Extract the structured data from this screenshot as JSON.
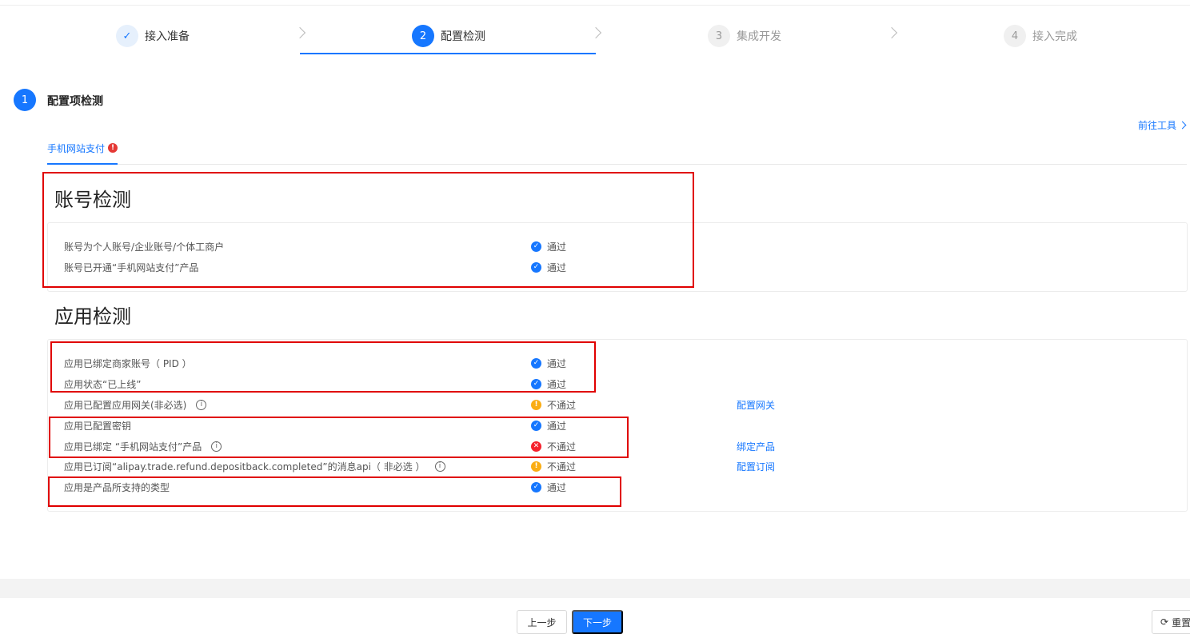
{
  "steps": [
    {
      "num": "✓",
      "label": "接入准备",
      "state": "done"
    },
    {
      "num": "2",
      "label": "配置检测",
      "state": "active"
    },
    {
      "num": "3",
      "label": "集成开发",
      "state": "todo"
    },
    {
      "num": "4",
      "label": "接入完成",
      "state": "todo"
    }
  ],
  "section": {
    "num": "1",
    "title": "配置项检测",
    "goto_tools": "前往工具"
  },
  "tab": {
    "label": "手机网站支付",
    "warn": "!"
  },
  "account": {
    "title": "账号检测",
    "rows": [
      {
        "label": "账号为个人账号/企业账号/个体工商户",
        "status": "通过"
      },
      {
        "label": "账号已开通“手机网站支付”产品",
        "status": "通过"
      }
    ]
  },
  "app": {
    "title": "应用检测",
    "rows": [
      {
        "label": "应用已绑定商家账号（ PID ）",
        "status": "通过",
        "action": ""
      },
      {
        "label": "应用状态“已上线”",
        "status": "通过",
        "action": ""
      },
      {
        "label": "应用已配置应用网关(非必选)",
        "status": "不通过",
        "action": "配置网关"
      },
      {
        "label": "应用已配置密钥",
        "status": "通过",
        "action": ""
      },
      {
        "label": "应用已绑定 “手机网站支付”产品",
        "status": "不通过",
        "action": "绑定产品"
      },
      {
        "label": "应用已订阅“alipay.trade.refund.depositback.completed”的消息api（ 非必选 ）",
        "status": "不通过",
        "action": "配置订阅"
      },
      {
        "label": "应用是产品所支持的类型",
        "status": "通过",
        "action": ""
      }
    ]
  },
  "footer": {
    "prev": "上一步",
    "next": "下一步",
    "reset": "重置"
  }
}
